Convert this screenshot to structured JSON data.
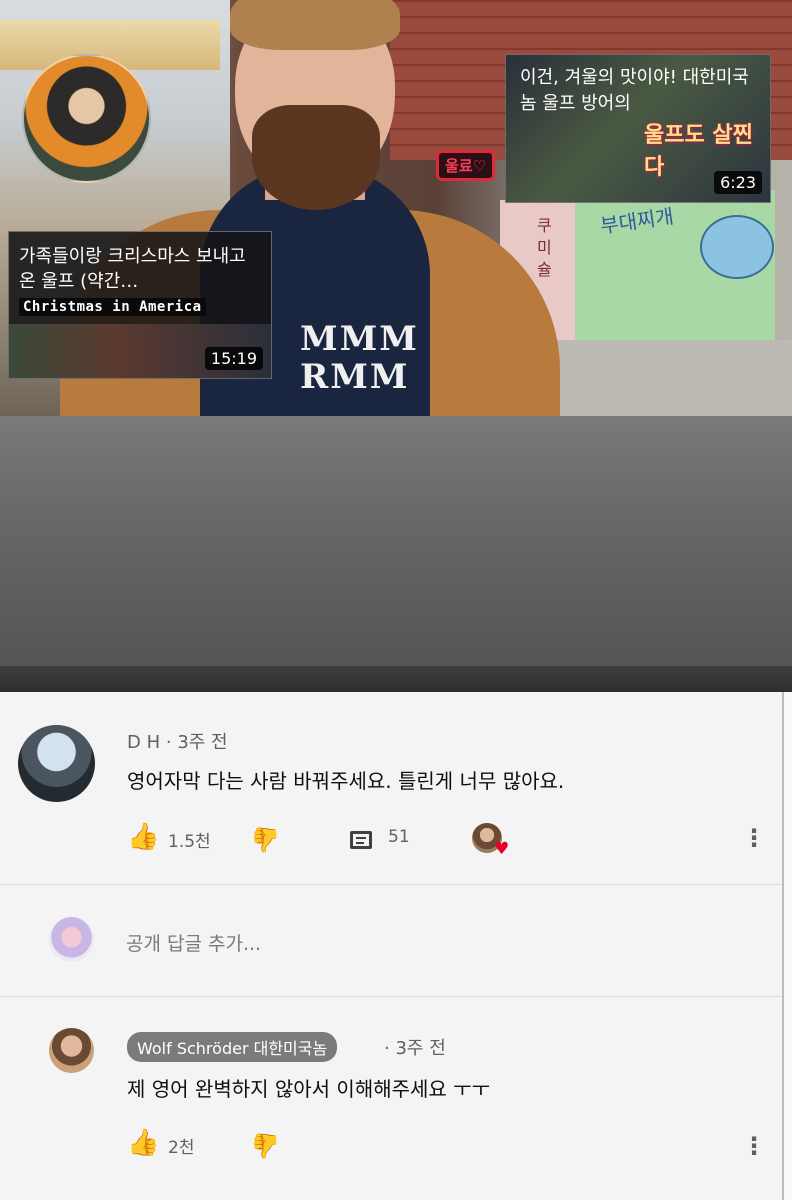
{
  "video": {
    "shirt_text": "MMM\nRMM",
    "neon_sign": "울료♡",
    "wall_text": "부대찌개",
    "wall_vertical": "쿠미슐",
    "card_left": {
      "title": "가족들이랑 크리스마스 보내고 온 울프 (약간…",
      "tag": "Christmas in America",
      "duration": "15:19"
    },
    "card_right": {
      "title": "이건, 겨울의 맛이야! 대한미국놈 울프 방어의",
      "overlay": "울프도 살찐다",
      "duration": "6:23"
    }
  },
  "comments": [
    {
      "author": "D H",
      "time": "3주 전",
      "text": "영어자막 다는 사람 바꿔주세요. 틀린게 너무 많아요.",
      "likes": "1.5천",
      "replies": "51",
      "creator_heart": true
    }
  ],
  "reply_box": {
    "placeholder": "공개 답글 추가..."
  },
  "reply": {
    "author": "Wolf Schröder 대한미국놈",
    "time": "3주 전",
    "text": "제 영어 완벽하지 않아서 이해해주세요 ㅜㅜ",
    "likes": "2천"
  },
  "icons": {
    "like": "thumb-up-icon",
    "dislike": "thumb-down-icon",
    "reply": "comment-icon",
    "more": "more-vert-icon",
    "heart": "heart-icon"
  },
  "colors": {
    "like_blue": "#065fd4",
    "heart_red": "#e4002b"
  }
}
